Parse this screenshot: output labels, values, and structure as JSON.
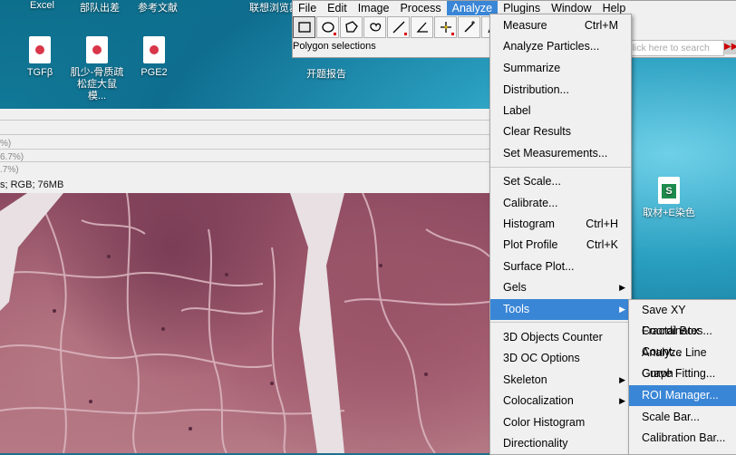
{
  "desktop": {
    "top_labels": [
      "Excel",
      "部队出差",
      "参考文献",
      "联想浏览器"
    ],
    "icons": [
      {
        "label": "TGFβ",
        "type": "pdf"
      },
      {
        "label": "肌少-骨质疏松症大鼠模...",
        "type": "pdf"
      },
      {
        "label": "PGE2",
        "type": "pdf"
      },
      {
        "label": "开题报告",
        "type": "folder"
      },
      {
        "label": "取材+E染色",
        "type": "xls"
      }
    ]
  },
  "image_window": {
    "rows": [
      "%)",
      "6.7%)",
      ".7%)"
    ],
    "status": "s; RGB; 76MB"
  },
  "imagej": {
    "menus": [
      "File",
      "Edit",
      "Image",
      "Process",
      "Analyze",
      "Plugins",
      "Window",
      "Help"
    ],
    "active_menu": "Analyze",
    "status": "Polygon selections",
    "search_placeholder": "Click here to search",
    "tools": [
      "rectangle-tool",
      "oval-tool",
      "polygon-tool",
      "freehand-tool",
      "line-tool",
      "angle-tool",
      "point-tool",
      "wand-tool",
      "text-tool"
    ]
  },
  "analyze_menu": {
    "items": [
      {
        "label": "Measure",
        "shortcut": "Ctrl+M"
      },
      {
        "label": "Analyze Particles...",
        "shortcut": ""
      },
      {
        "label": "Summarize",
        "shortcut": ""
      },
      {
        "label": "Distribution...",
        "shortcut": ""
      },
      {
        "label": "Label",
        "shortcut": ""
      },
      {
        "label": "Clear Results",
        "shortcut": ""
      },
      {
        "label": "Set Measurements...",
        "shortcut": ""
      },
      {
        "label": "Set Scale...",
        "shortcut": ""
      },
      {
        "label": "Calibrate...",
        "shortcut": ""
      },
      {
        "label": "Histogram",
        "shortcut": "Ctrl+H"
      },
      {
        "label": "Plot Profile",
        "shortcut": "Ctrl+K"
      },
      {
        "label": "Surface Plot...",
        "shortcut": ""
      },
      {
        "label": "Gels",
        "shortcut": ""
      },
      {
        "label": "Tools",
        "shortcut": ""
      },
      {
        "label": "3D Objects Counter",
        "shortcut": ""
      },
      {
        "label": "3D OC Options",
        "shortcut": ""
      },
      {
        "label": "Skeleton",
        "shortcut": ""
      },
      {
        "label": "Colocalization",
        "shortcut": ""
      },
      {
        "label": "Color Histogram",
        "shortcut": ""
      },
      {
        "label": "Directionality",
        "shortcut": ""
      }
    ],
    "highlighted": "Tools"
  },
  "tools_menu": {
    "items": [
      "Save XY Coordinates...",
      "Fractal Box Count...",
      "Analyze Line Graph",
      "Curve Fitting...",
      "ROI Manager...",
      "Scale Bar...",
      "Calibration Bar..."
    ],
    "highlighted": "ROI Manager..."
  },
  "colors": {
    "highlight": "#3a86d6",
    "menu_bg": "#f0f0f0"
  }
}
